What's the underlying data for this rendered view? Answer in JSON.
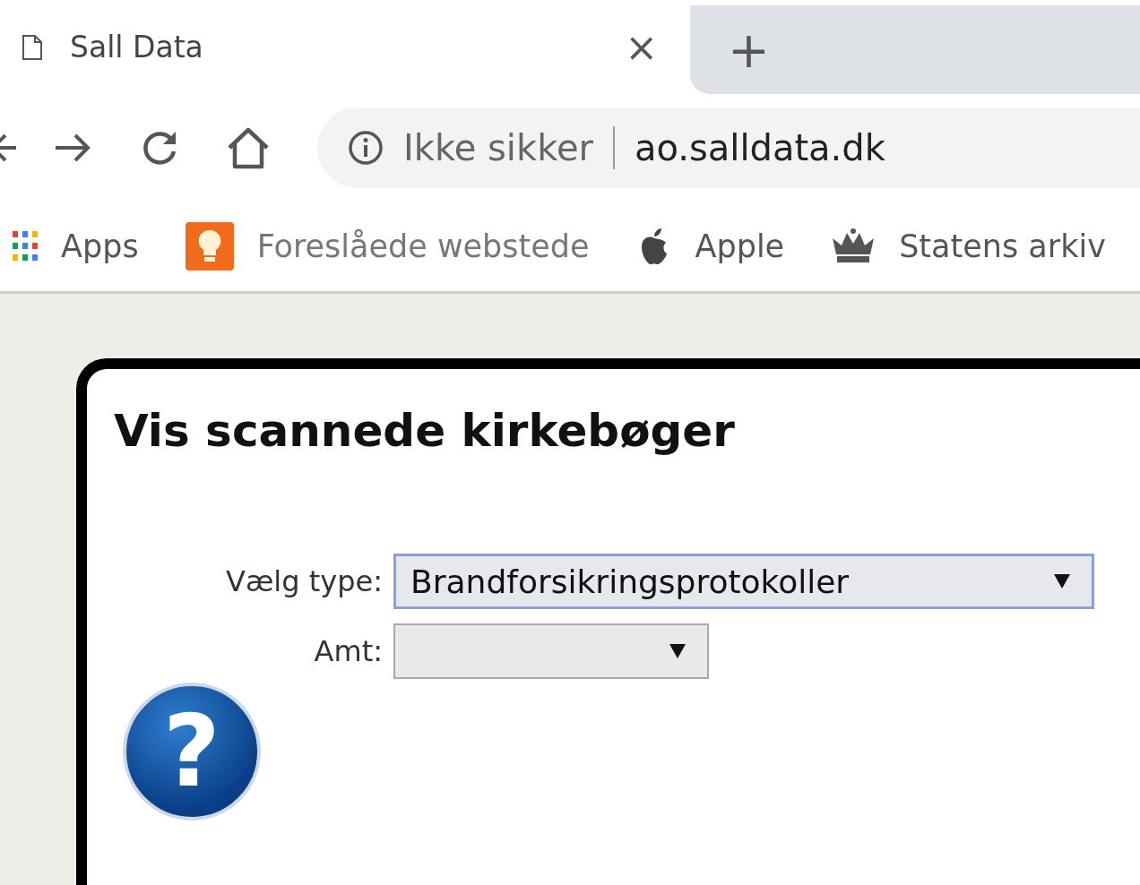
{
  "tab": {
    "title": "Sall Data",
    "close": "×",
    "new_tab": "+"
  },
  "address_bar": {
    "security": "Ikke sikker",
    "url": "ao.salldata.dk"
  },
  "bookmarks": [
    {
      "label": "Apps",
      "kind": "apps"
    },
    {
      "label": "Foreslåede webstede",
      "kind": "bulb"
    },
    {
      "label": "Apple",
      "kind": "apple"
    },
    {
      "label": "Statens arkiv",
      "kind": "crown"
    }
  ],
  "page": {
    "heading": "Vis scannede kirkebøger",
    "fields": [
      {
        "label": "Vælg type:",
        "value": "Brandforsikringsprotokoller",
        "focused": true,
        "kind": "wide"
      },
      {
        "label": "Amt:",
        "focused": false,
        "kind": "narrow"
      }
    ],
    "help": "?"
  }
}
